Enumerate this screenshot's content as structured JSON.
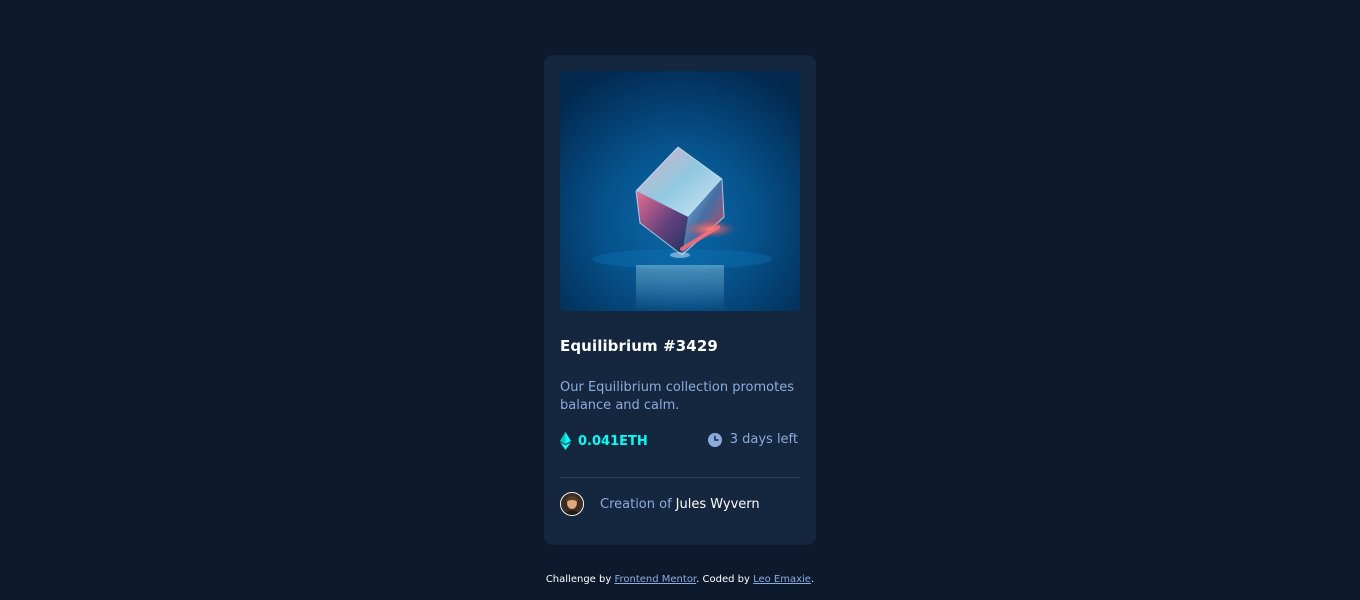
{
  "colors": {
    "page_bg": "#0d192c",
    "card_bg": "#15263f",
    "accent_cyan": "#00fff8",
    "soft_blue": "#8bacda",
    "white": "#ffffff",
    "divider": "#2e405a"
  },
  "card": {
    "image_icon": "equilibrium-cube-image",
    "title": "Equilibrium #3429",
    "description": "Our Equilibrium collection promotes balance and calm.",
    "price": {
      "icon": "ethereum-icon",
      "label": "0.041ETH"
    },
    "time": {
      "icon": "clock-icon",
      "label": "3 days left"
    },
    "creator": {
      "prefix": "Creation of",
      "name": "Jules Wyvern"
    }
  },
  "attribution": {
    "prefix": "Challenge by",
    "link1": "Frontend Mentor",
    "middle": ". Coded by",
    "link2": "Leo Emaxie",
    "suffix": "."
  }
}
